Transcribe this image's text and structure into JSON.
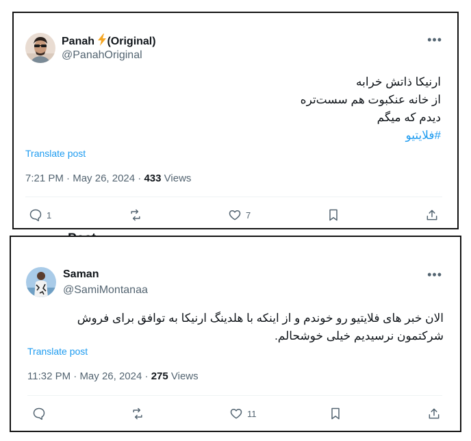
{
  "background_header": {
    "back_icon": "arrow-left-icon",
    "title": "Post"
  },
  "tweets": [
    {
      "author": {
        "name": "Panah",
        "badge_icon": "lightning-icon",
        "name_suffix": "(Original)",
        "handle": "@PanahOriginal"
      },
      "text_lines": [
        "ارنیکا ذاتش خرابه",
        "از خانه عنکبوت هم سست‌تره",
        "دیدم که میگم"
      ],
      "hashtag": "#فلایتیو",
      "translate_label": "Translate post",
      "time": "7:21 PM",
      "date": "May 26, 2024",
      "views_count": "433",
      "views_label": "Views",
      "replies": "1",
      "reposts": "",
      "likes": "7"
    },
    {
      "author": {
        "name": "Saman",
        "handle": "@SamiMontanaa"
      },
      "text_lines": [
        "الان خبر های فلایتیو رو خوندم و از اینکه با هلدینگ ارنیکا به توافق برای فروش",
        "شرکتمون نرسیدیم خیلی خوشحالم."
      ],
      "translate_label": "Translate post",
      "time": "11:32 PM",
      "date": "May 26, 2024",
      "views_count": "275",
      "views_label": "Views",
      "replies": "",
      "reposts": "",
      "likes": "11"
    }
  ],
  "colors": {
    "link": "#1d9bf0",
    "secondary": "#536471",
    "primary": "#0f1419",
    "badge": "#f5a623"
  }
}
